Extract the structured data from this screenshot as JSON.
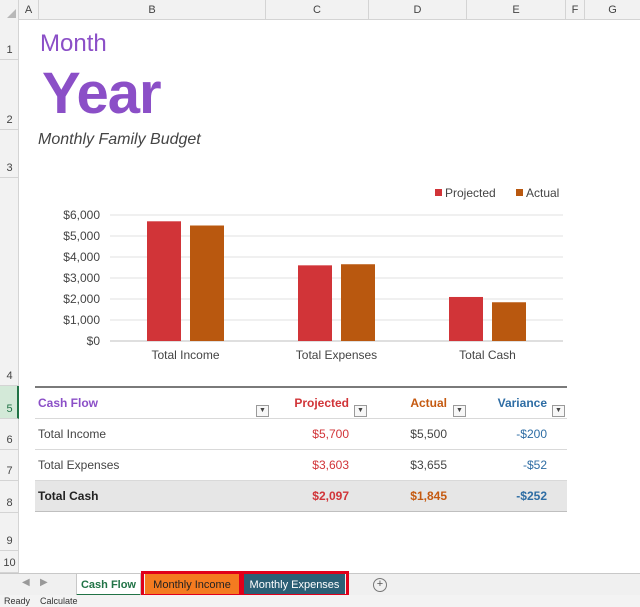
{
  "columns": [
    "A",
    "B",
    "C",
    "D",
    "E",
    "F",
    "G"
  ],
  "rows": [
    "1",
    "2",
    "3",
    "4",
    "5",
    "6",
    "7",
    "8",
    "9",
    "10"
  ],
  "title": {
    "month": "Month",
    "year": "Year",
    "subtitle": "Monthly Family Budget"
  },
  "chart_data": {
    "type": "bar",
    "categories": [
      "Total Income",
      "Total Expenses",
      "Total Cash"
    ],
    "series": [
      {
        "name": "Projected",
        "values": [
          5700,
          3603,
          2097
        ],
        "color": "#d13438"
      },
      {
        "name": "Actual",
        "values": [
          5500,
          3655,
          1845
        ],
        "color": "#b9580f"
      }
    ],
    "ylim": [
      0,
      6000
    ],
    "yticks": [
      "$0",
      "$1,000",
      "$2,000",
      "$3,000",
      "$4,000",
      "$5,000",
      "$6,000"
    ],
    "grid": true,
    "legend": "top-right"
  },
  "table": {
    "headers": [
      "Cash Flow",
      "Projected",
      "Actual",
      "Variance"
    ],
    "rows": [
      {
        "label": "Total Income",
        "projected": "$5,700",
        "actual": "$5,500",
        "variance": "-$200"
      },
      {
        "label": "Total Expenses",
        "projected": "$3,603",
        "actual": "$3,655",
        "variance": "-$52"
      },
      {
        "label": "Total Cash",
        "projected": "$2,097",
        "actual": "$1,845",
        "variance": "-$252"
      }
    ]
  },
  "tabs": [
    {
      "label": "Cash Flow",
      "active": true,
      "color": "#ffffff"
    },
    {
      "label": "Monthly Income",
      "active": false,
      "color": "#f47b20"
    },
    {
      "label": "Monthly Expenses",
      "active": false,
      "color": "#2b5f75"
    }
  ],
  "status": {
    "ready": "Ready",
    "calculate": "Calculate"
  },
  "colors": {
    "accent_purple": "#8b4fc7",
    "projected_red": "#d13438",
    "actual_orange": "#c55a11",
    "variance_blue": "#2e6da4",
    "highlight_box": "#e0001a"
  }
}
